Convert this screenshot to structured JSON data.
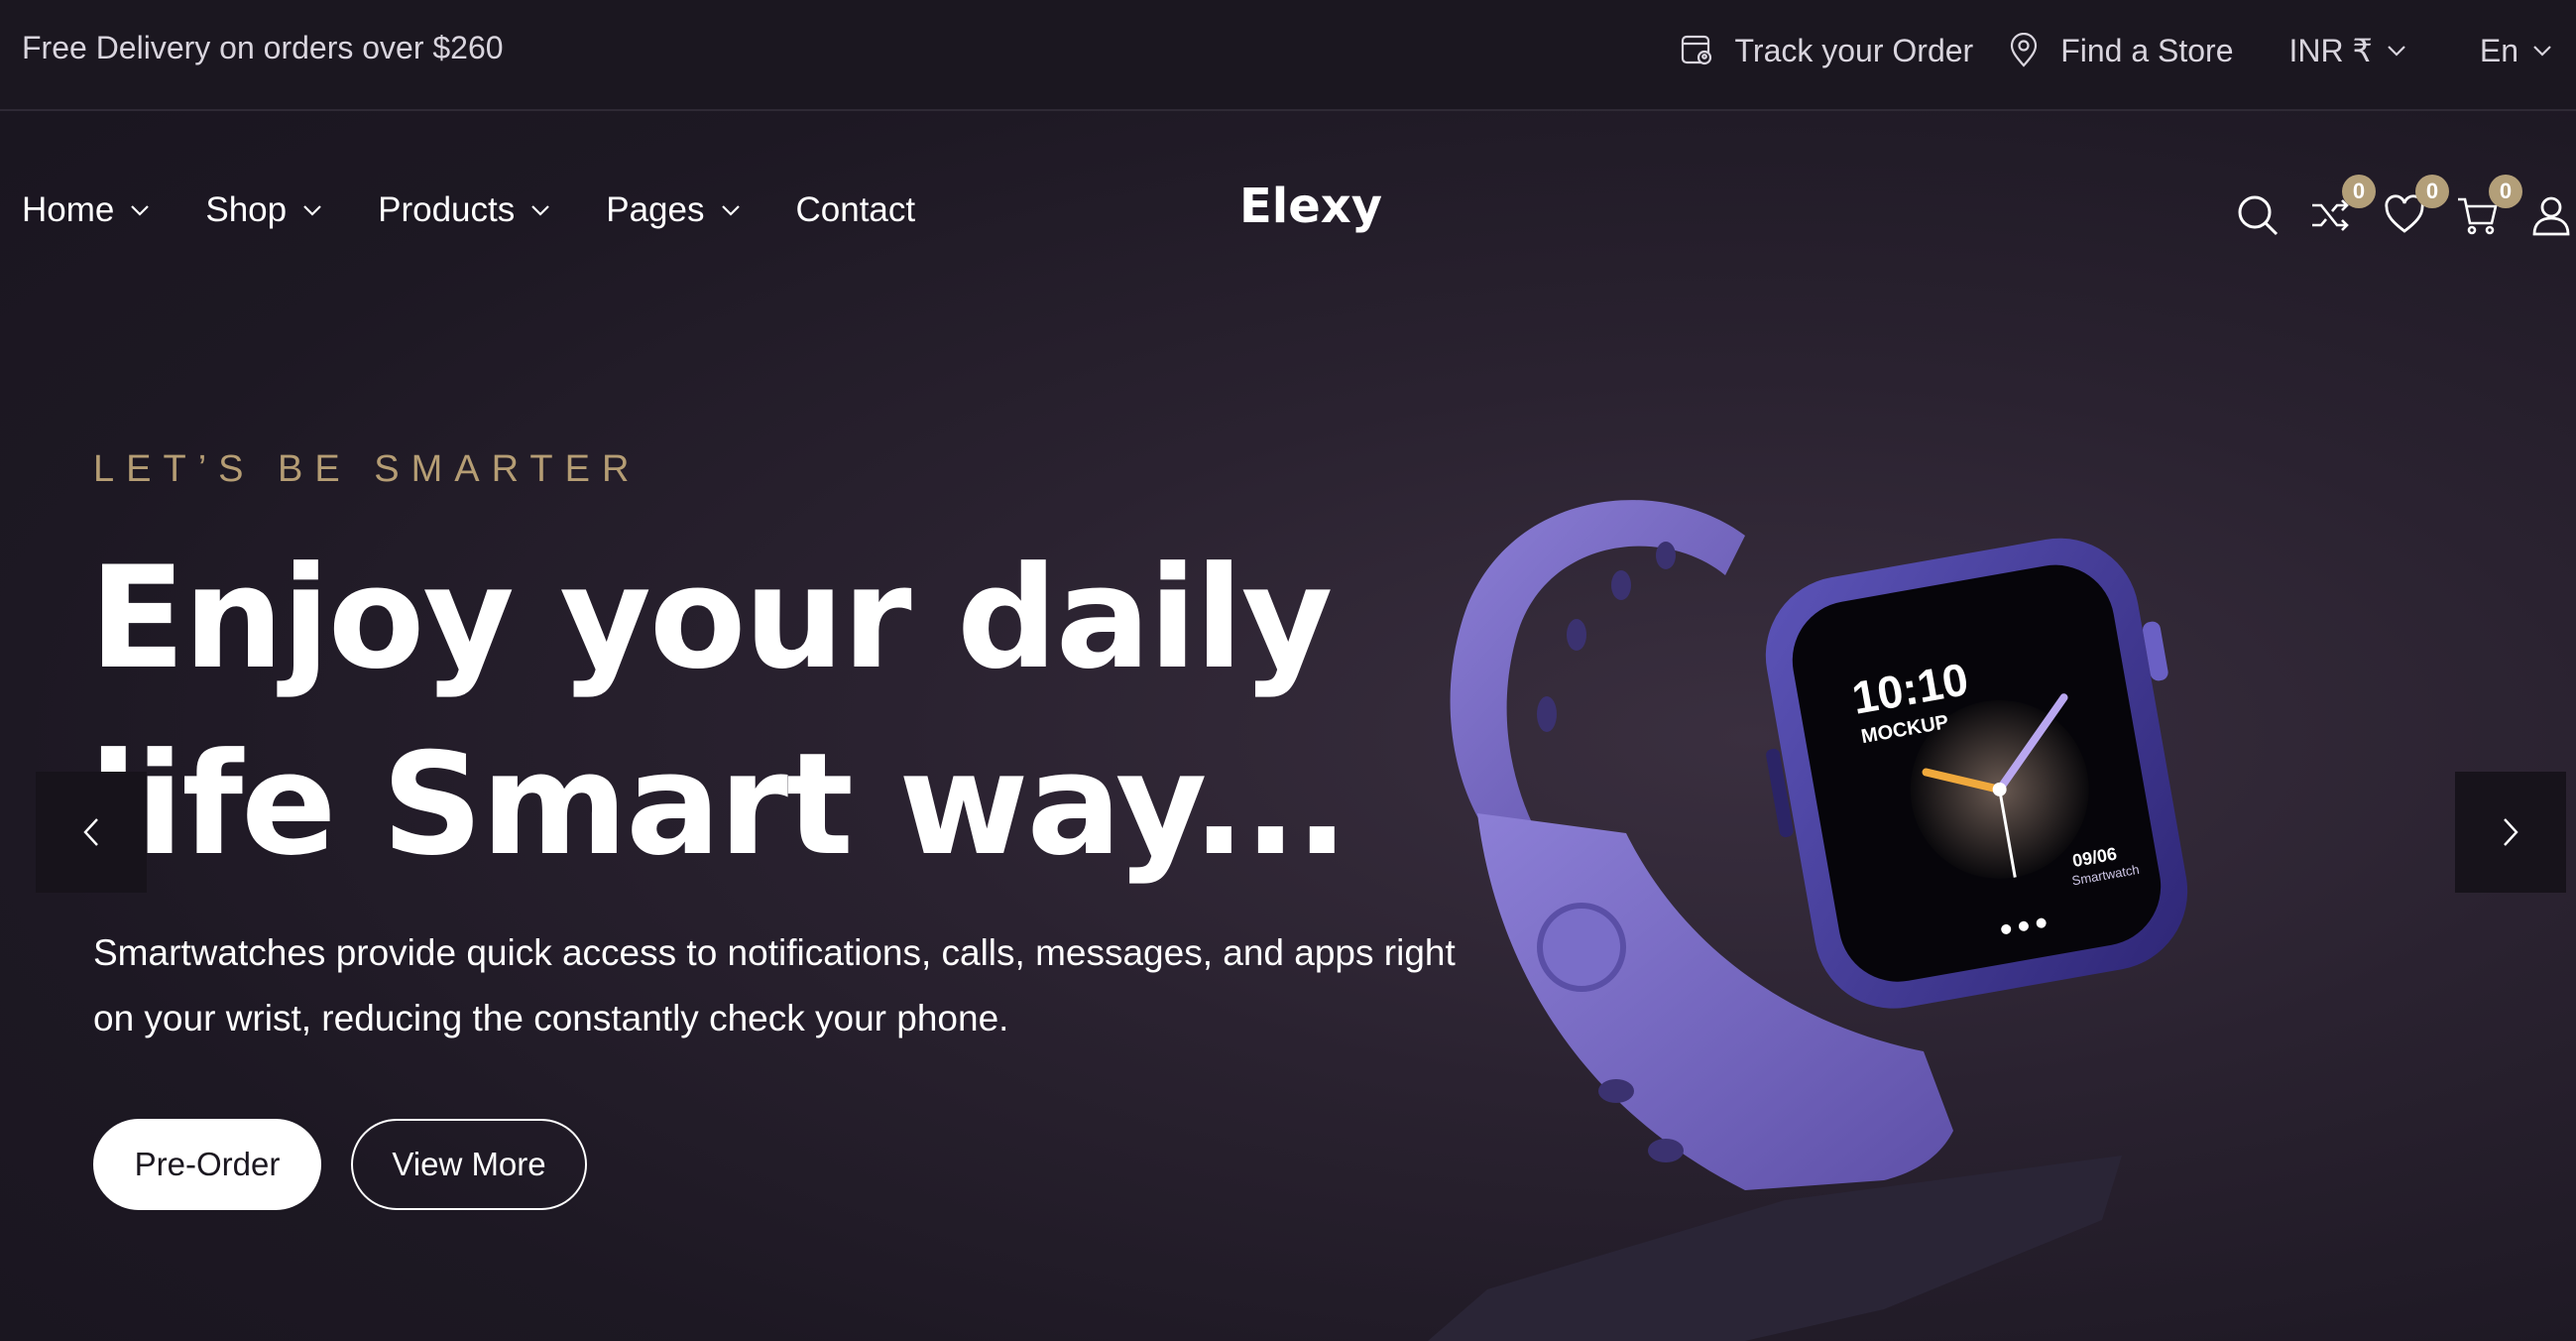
{
  "topbar": {
    "promo": "Free Delivery on orders over $260",
    "track_label": "Track your Order",
    "store_label": "Find a Store",
    "currency": "INR ₹",
    "language": "En"
  },
  "nav": {
    "menu": [
      {
        "label": "Home",
        "has_dropdown": true
      },
      {
        "label": "Shop",
        "has_dropdown": true
      },
      {
        "label": "Products",
        "has_dropdown": true
      },
      {
        "label": "Pages",
        "has_dropdown": true
      },
      {
        "label": "Contact",
        "has_dropdown": false
      }
    ],
    "logo": "Elexy",
    "icons": {
      "search": "search-icon",
      "compare": "shuffle-icon",
      "wishlist": "heart-icon",
      "cart": "cart-icon",
      "account": "user-icon"
    },
    "badges": {
      "compare": "0",
      "wishlist": "0",
      "cart": "0"
    }
  },
  "hero": {
    "eyebrow": "LET’S BE SMARTER",
    "headline_line1": "Enjoy your daily",
    "headline_line2": "life Smart way...",
    "description": "Smartwatches provide quick access to notifications, calls, messages, and apps right on your wrist, reducing the constantly check your phone.",
    "primary_button": "Pre-Order",
    "secondary_button": "View More",
    "watch_time": "10:10",
    "watch_label": "MOCKUP",
    "watch_date": "09/06",
    "watch_sub": "Smartwatch"
  },
  "colors": {
    "accent": "#b59d74",
    "badge": "#b39f79",
    "background": "#1c1722",
    "watch_band": "#7a6bc0"
  }
}
